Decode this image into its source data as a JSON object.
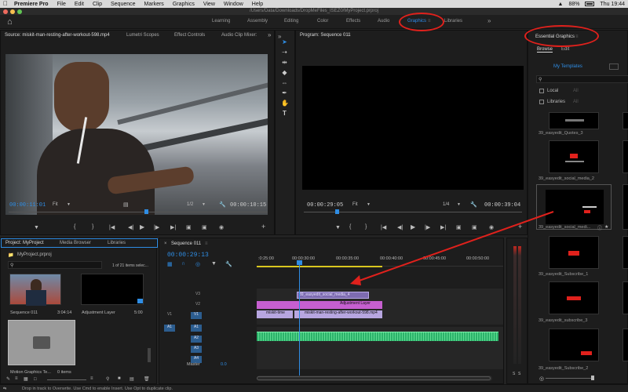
{
  "menubar": {
    "app": "Premiere Pro",
    "items": [
      "File",
      "Edit",
      "Clip",
      "Sequence",
      "Markers",
      "Graphics",
      "View",
      "Window",
      "Help"
    ],
    "battery": "88%",
    "clock": "Thu 19:44"
  },
  "title": "/Users/Data/Downloads/DropMeFiles_ISEZ0/MyProject.prproj",
  "workspaces": [
    "Learning",
    "Assembly",
    "Editing",
    "Color",
    "Effects",
    "Audio",
    "Graphics",
    "Libraries"
  ],
  "source": {
    "tabs": [
      "Source: miskit-man-resting-after-workout-598.mp4",
      "Lumetri Scopes",
      "Effect Controls",
      "Audio Clip Mixer:"
    ],
    "timecode_left": "00:00:11:01",
    "fit": "Fit",
    "ratio": "1/2",
    "timecode_right": "00:00:10:15"
  },
  "program": {
    "tab": "Program: Sequence 011",
    "timecode_left": "00:00:29:05",
    "fit": "Fit",
    "ratio": "1/4",
    "timecode_right": "00:00:39:04"
  },
  "essential_graphics": {
    "title": "Essential Graphics",
    "tabs": [
      "Browse",
      "Edit"
    ],
    "my_templates": "My Templates",
    "local": "Local",
    "libraries": "Libraries",
    "all": "All",
    "template_labels": [
      "39_easyedit_Quotes_3",
      "39_easyedit_social_media_2",
      "39_easyedit_social_medi...",
      "39_easyedit_Subscribe_1",
      "39_easyedit_subscribe_3",
      "39_easyedit_Subscribe_2"
    ]
  },
  "project": {
    "tabs": [
      "Project: MyProject",
      "Media Browser",
      "Libraries"
    ],
    "file": "MyProject.prproj",
    "count": "1 of 21 items selec...",
    "items": [
      {
        "name": "Sequence 011",
        "duration": "3:04:14"
      },
      {
        "name": "Adjustment Layer",
        "duration": "5:00"
      },
      {
        "name": "Motion Graphics Te...",
        "duration": "0 items"
      }
    ]
  },
  "timeline": {
    "tab": "Sequence 011",
    "timecode": "00:00:29:13",
    "ruler": [
      ":0:25:00",
      "00:00:30:00",
      "00:00:35:00",
      "00:00:40:00",
      "00:00:45:00",
      "00:00:50:00"
    ],
    "tracks": [
      "V3",
      "V2",
      "V1",
      "A1",
      "A2",
      "A3",
      "A4"
    ],
    "source_patch": [
      "V1",
      "A1"
    ],
    "master": "Master",
    "master_value": "0.0",
    "clips": {
      "graphic": "39_easyedit_social_media_4",
      "adjustment": "Adjustment Layer",
      "video1": "miskit-time",
      "video2": "miskit-man-resting-after-workout-598.mp4"
    }
  },
  "audio_meter": {
    "labels": [
      "S",
      "S"
    ]
  },
  "status": "Drop in track to Overwrite. Use Cmd to enable Insert. Use Opt to duplicate clip.",
  "colors": {
    "accent": "#2d8ceb",
    "annotation": "#e0211c",
    "graphic_clip": "#7d6bb0",
    "adjust_clip": "#c65fd0",
    "audio_clip": "#2bb36a"
  }
}
